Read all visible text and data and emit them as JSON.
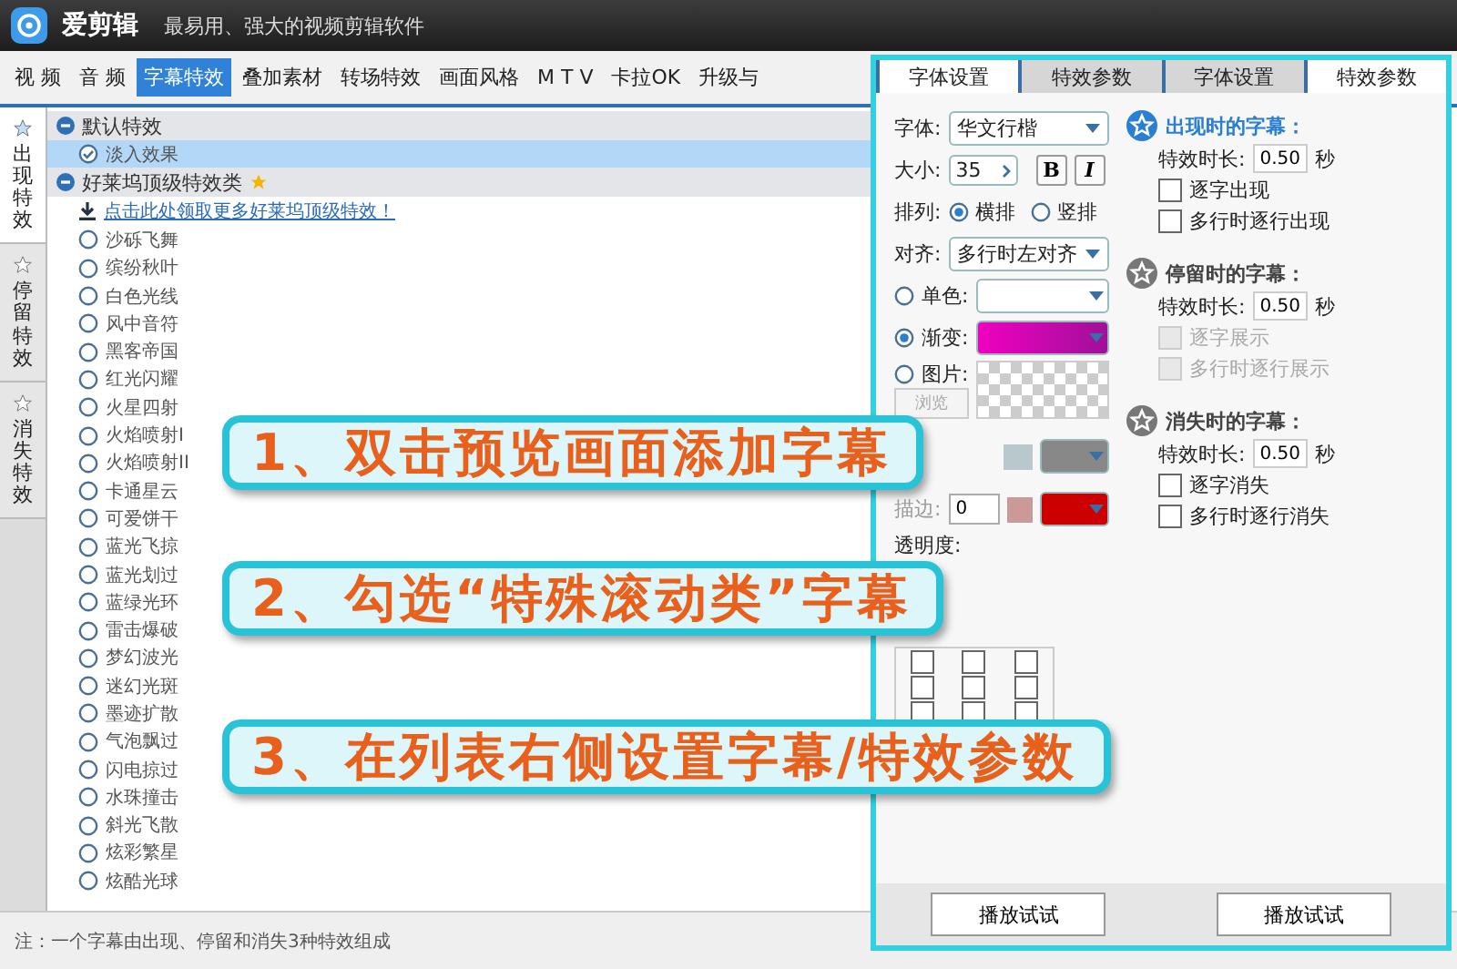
{
  "app": {
    "name": "爱剪辑",
    "tagline": "最易用、强大的视频剪辑软件"
  },
  "main_tabs": [
    {
      "label": "视 频",
      "selected": false
    },
    {
      "label": "音 频",
      "selected": false
    },
    {
      "label": "字幕特效",
      "selected": true
    },
    {
      "label": "叠加素材",
      "selected": false
    },
    {
      "label": "转场特效",
      "selected": false
    },
    {
      "label": "画面风格",
      "selected": false
    },
    {
      "label": "M T V",
      "selected": false
    },
    {
      "label": "卡拉OK",
      "selected": false
    },
    {
      "label": "升级与",
      "selected": false
    }
  ],
  "side_tabs": [
    {
      "label": "出现特效",
      "selected": true
    },
    {
      "label": "停留特效",
      "selected": false
    },
    {
      "label": "消失特效",
      "selected": false
    }
  ],
  "effect_groups": [
    {
      "title": "默认特效",
      "expanded": true,
      "starred": false,
      "items": [
        {
          "label": "淡入效果",
          "selected": true
        }
      ]
    },
    {
      "title": "好莱坞顶级特效类",
      "expanded": true,
      "starred": true,
      "link": "点击此处领取更多好莱坞顶级特效！",
      "items": [
        {
          "label": "沙砾飞舞",
          "selected": false
        },
        {
          "label": "缤纷秋叶",
          "selected": false
        },
        {
          "label": "白色光线",
          "selected": false
        },
        {
          "label": "风中音符",
          "selected": false
        },
        {
          "label": "黑客帝国",
          "selected": false
        },
        {
          "label": "红光闪耀",
          "selected": false
        },
        {
          "label": "火星四射",
          "selected": false
        },
        {
          "label": "火焰喷射I",
          "selected": false
        },
        {
          "label": "火焰喷射II",
          "selected": false
        },
        {
          "label": "卡通星云",
          "selected": false
        },
        {
          "label": "可爱饼干",
          "selected": false
        },
        {
          "label": "蓝光飞掠",
          "selected": false
        },
        {
          "label": "蓝光划过",
          "selected": false
        },
        {
          "label": "蓝绿光环",
          "selected": false
        },
        {
          "label": "雷击爆破",
          "selected": false
        },
        {
          "label": "梦幻波光",
          "selected": false
        },
        {
          "label": "迷幻光斑",
          "selected": false
        },
        {
          "label": "墨迹扩散",
          "selected": false
        },
        {
          "label": "气泡飘过",
          "selected": false
        },
        {
          "label": "闪电掠过",
          "selected": false
        },
        {
          "label": "水珠撞击",
          "selected": false
        },
        {
          "label": "斜光飞散",
          "selected": false
        },
        {
          "label": "炫彩繁星",
          "selected": false
        },
        {
          "label": "炫酷光球",
          "selected": false
        }
      ]
    }
  ],
  "note": "注：一个字幕由出现、停留和消失3种特效组成",
  "panel": {
    "tabs": [
      {
        "label": "字体设置",
        "selected": true
      },
      {
        "label": "特效参数",
        "selected": false
      },
      {
        "label": "字体设置",
        "selected": false
      },
      {
        "label": "特效参数",
        "selected": true
      }
    ],
    "font": {
      "label": "字体:",
      "value": "华文行楷"
    },
    "size": {
      "label": "大小:",
      "value": "35"
    },
    "bold": "B",
    "italic": "I",
    "arrange": {
      "label": "排列:",
      "options": [
        {
          "label": "横排",
          "selected": true
        },
        {
          "label": "竖排",
          "selected": false
        }
      ]
    },
    "align": {
      "label": "对齐:",
      "value": "多行时左对齐"
    },
    "fill_options": [
      {
        "label": "单色:",
        "selected": false,
        "kind": "solid"
      },
      {
        "label": "渐变:",
        "selected": true,
        "kind": "gradient"
      },
      {
        "label": "图片:",
        "selected": false,
        "kind": "image",
        "button": "浏览"
      }
    ],
    "stroke": {
      "label": "描边:",
      "value": "0"
    },
    "opacity_label": "透明度:",
    "positions": [
      {
        "checked": false
      },
      {
        "checked": false
      },
      {
        "checked": false
      },
      {
        "checked": false
      },
      {
        "checked": false
      },
      {
        "checked": false
      },
      {
        "checked": false
      },
      {
        "checked": false
      },
      {
        "checked": false
      }
    ],
    "phases": [
      {
        "title": "出现时的字幕：",
        "active": true,
        "duration_label": "特效时长:",
        "duration": "0.50",
        "unit": "秒",
        "options": [
          {
            "label": "逐字出现",
            "checked": false,
            "disabled": false
          },
          {
            "label": "多行时逐行出现",
            "checked": false,
            "disabled": false
          }
        ]
      },
      {
        "title": "停留时的字幕：",
        "active": false,
        "duration_label": "特效时长:",
        "duration": "0.50",
        "unit": "秒",
        "options": [
          {
            "label": "逐字展示",
            "checked": false,
            "disabled": true
          },
          {
            "label": "多行时逐行展示",
            "checked": false,
            "disabled": true
          }
        ]
      },
      {
        "title": "消失时的字幕：",
        "active": false,
        "duration_label": "特效时长:",
        "duration": "0.50",
        "unit": "秒",
        "options": [
          {
            "label": "逐字消失",
            "checked": false,
            "disabled": false
          },
          {
            "label": "多行时逐行消失",
            "checked": false,
            "disabled": false
          }
        ]
      }
    ],
    "buttons": [
      "播放试试",
      "播放试试"
    ]
  },
  "callouts": [
    "1、双击预览画面添加字幕",
    "2、勾选“特殊滚动类”字幕",
    "3、在列表右侧设置字幕/特效参数"
  ]
}
